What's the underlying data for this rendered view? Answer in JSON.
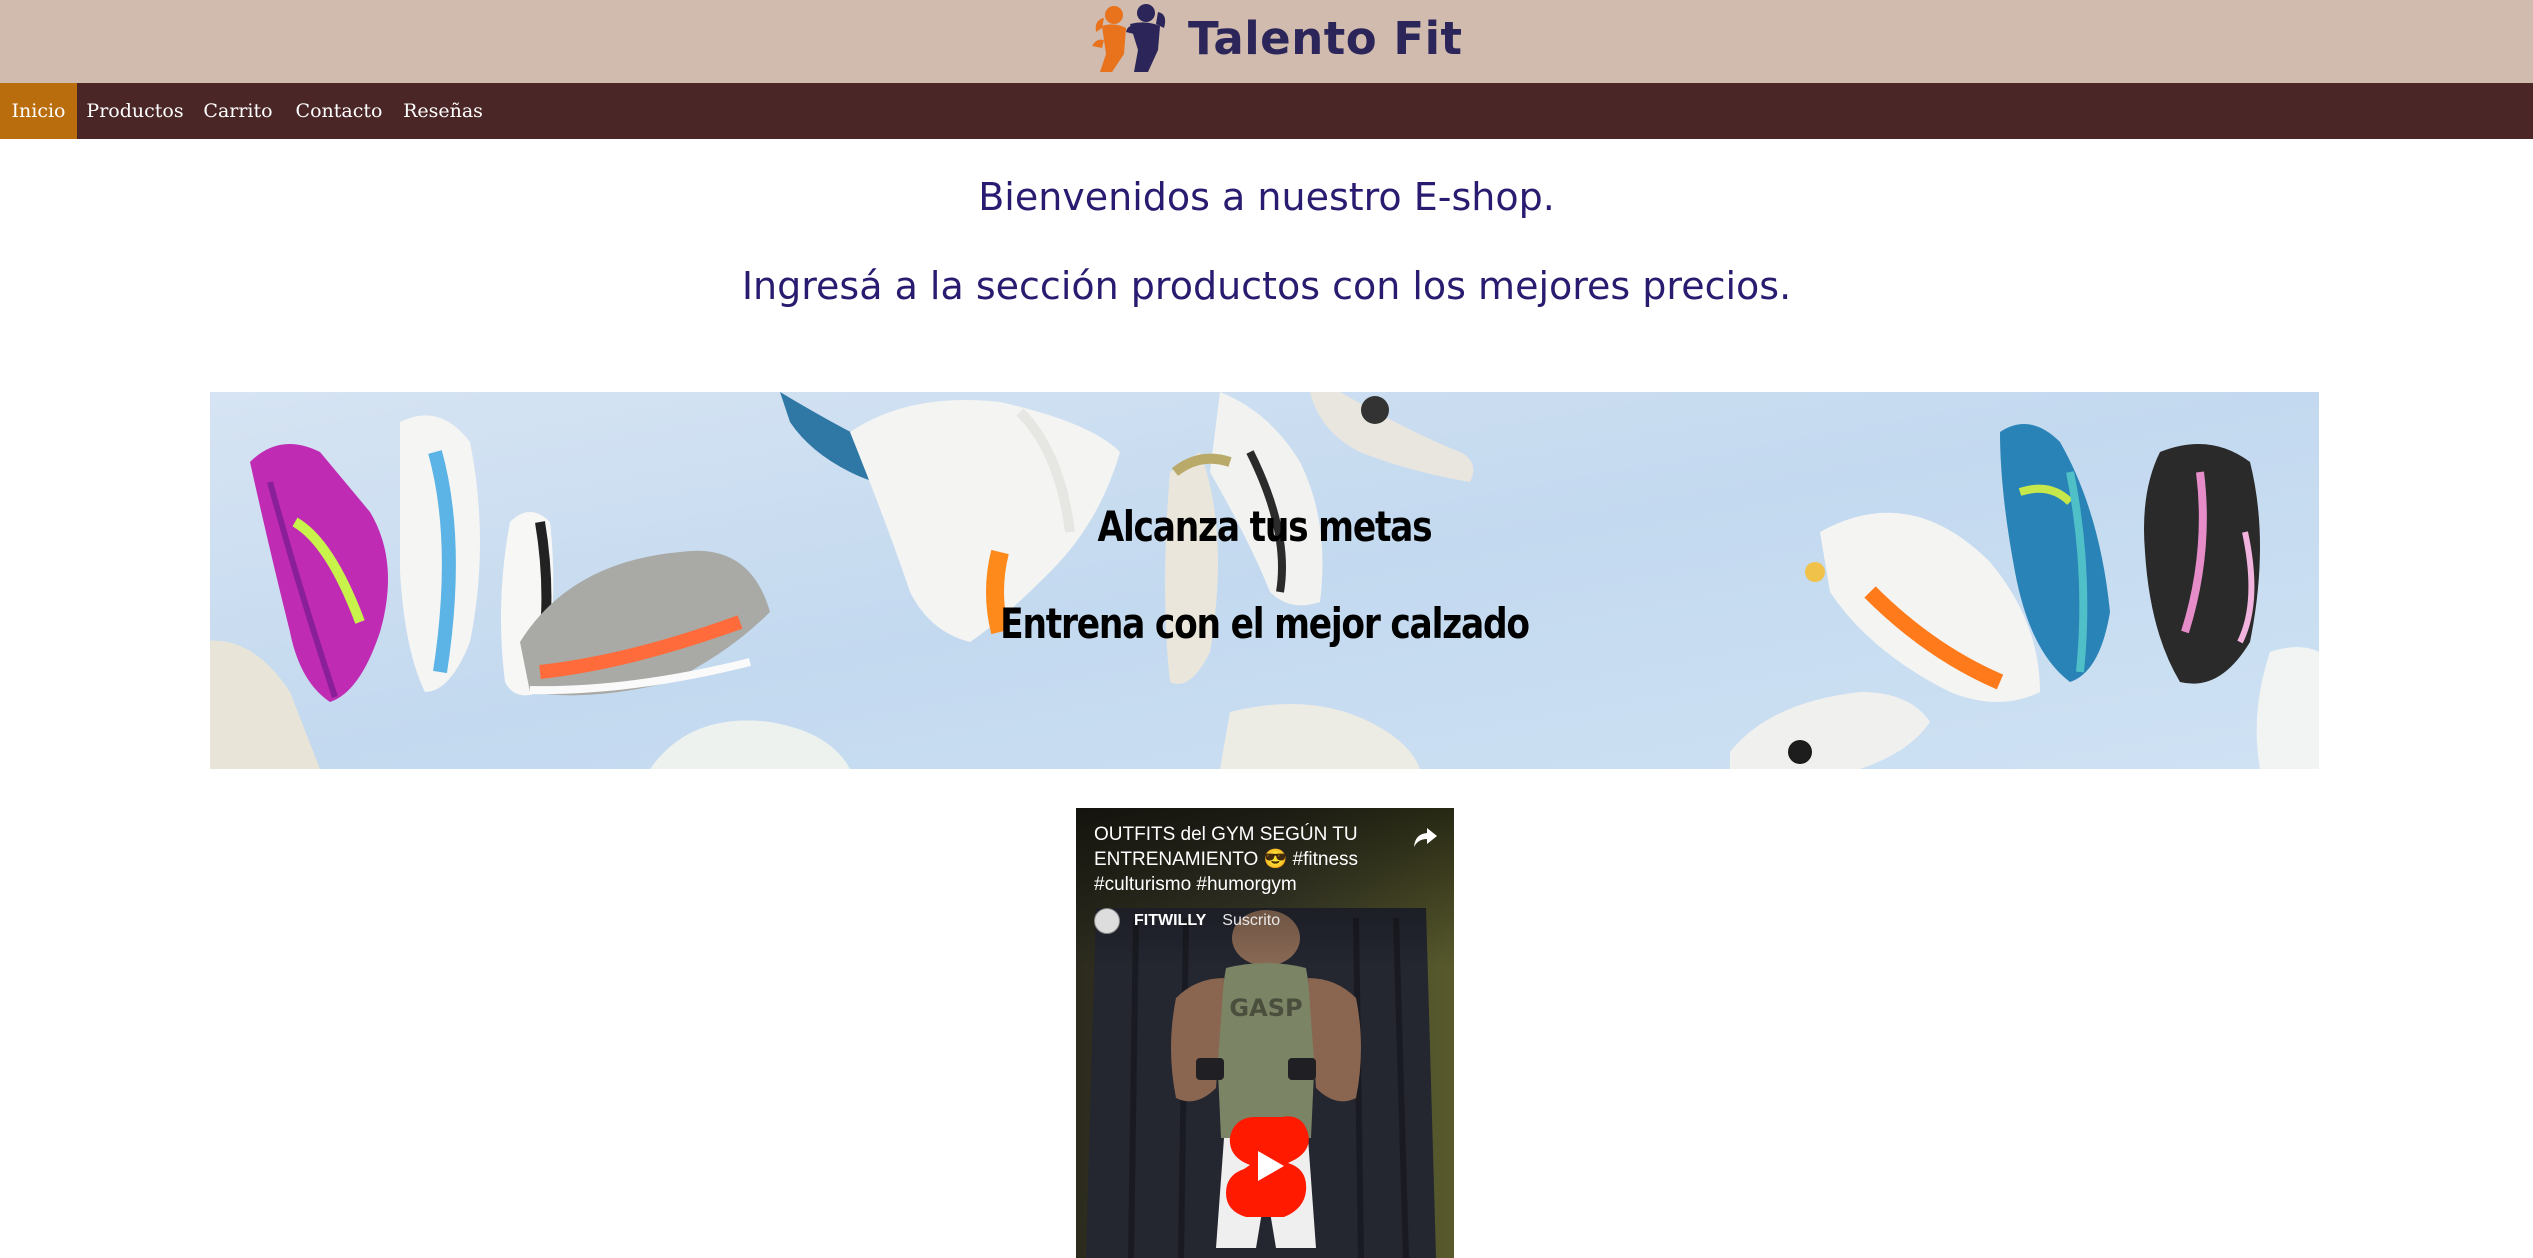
{
  "header": {
    "brand_name": "Talento Fit",
    "logo_icon": "fitness-couple-logo-icon"
  },
  "nav": {
    "items": [
      {
        "label": "Inicio",
        "active": true
      },
      {
        "label": "Productos",
        "active": false
      },
      {
        "label": "Carrito",
        "active": false
      },
      {
        "label": "Contacto",
        "active": false
      },
      {
        "label": "Reseñas",
        "active": false
      }
    ]
  },
  "main": {
    "welcome_line1": "Bienvenidos a nuestro E-shop.",
    "welcome_line2": "Ingresá a la sección productos con los mejores precios."
  },
  "banner": {
    "line1": "Alcanza tus metas",
    "line2": "Entrena con el mejor calzado"
  },
  "video": {
    "title": "OUTFITS del GYM SEGÚN TU ENTRENAMIENTO 😎 #fitness #culturismo #humorgym",
    "channel": "FITWILLY",
    "subscribe_status": "Suscrito",
    "shirt_text": "GASP",
    "icons": [
      "share-icon",
      "youtube-shorts-play-icon"
    ]
  },
  "colors": {
    "header_bg": "#d0bbae",
    "nav_bg": "#4a2626",
    "nav_active_bg": "#b96d0c",
    "brand_text": "#2b2559",
    "welcome_text": "#2a1b70",
    "play_button": "#ff0000"
  }
}
